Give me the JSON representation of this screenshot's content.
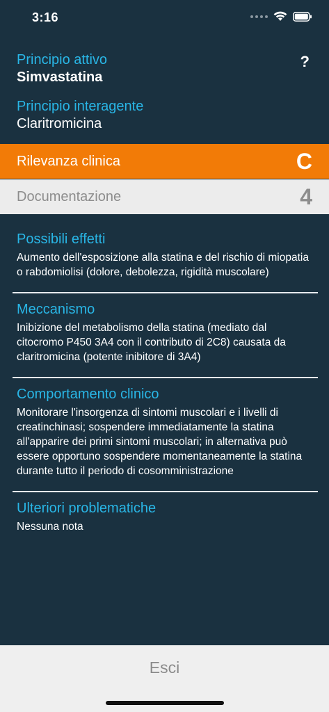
{
  "status_bar": {
    "time": "3:16",
    "icons": [
      "signal-dots-icon",
      "wifi-icon",
      "battery-icon"
    ]
  },
  "header": {
    "active_label": "Principio attivo",
    "active_value": "Simvastatina",
    "interacting_label": "Principio interagente",
    "interacting_value": "Claritromicina",
    "help_label": "?"
  },
  "clinical_relevance": {
    "label": "Rilevanza clinica",
    "value": "C",
    "color": "#f27b07"
  },
  "documentation": {
    "label": "Documentazione",
    "value": "4"
  },
  "sections": [
    {
      "title": "Possibili effetti",
      "body": "Aumento dell'esposizione alla statina e del rischio di miopatia o rabdomiolisi (dolore, debolezza, rigidità muscolare)"
    },
    {
      "title": "Meccanismo",
      "body": "Inibizione del metabolismo della statina (mediato dal citocromo P450 3A4 con il contributo di 2C8) causata da claritromicina (potente inibitore di 3A4)"
    },
    {
      "title": "Comportamento clinico",
      "body": "Monitorare l'insorgenza di sintomi muscolari e i livelli di creatinchinasi; sospendere immediatamente la statina all'apparire dei primi sintomi muscolari; in alternativa può essere opportuno sospendere momentaneamente la statina durante tutto il periodo di cosomministrazione"
    },
    {
      "title": "Ulteriori problematiche",
      "body": "Nessuna nota"
    }
  ],
  "footer": {
    "exit_label": "Esci"
  },
  "colors": {
    "background": "#1a3140",
    "accent_cyan": "#29b6e6",
    "orange": "#f27b07"
  }
}
